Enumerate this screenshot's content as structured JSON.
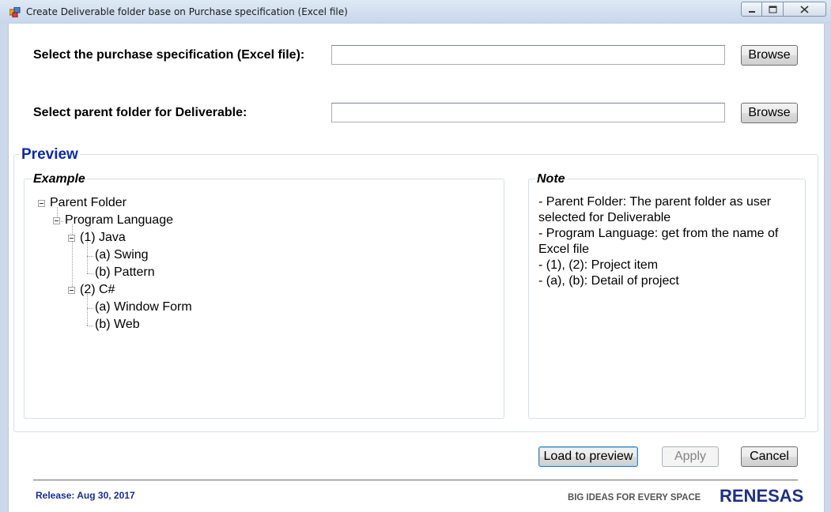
{
  "window": {
    "title": "Create Deliverable folder base on Purchase specification (Excel file)",
    "minimize_glyph": "▬",
    "maximize_glyph": "▢",
    "close_glyph": "✕"
  },
  "form": {
    "purchase_spec_label": "Select the purchase specification (Excel file):",
    "purchase_spec_value": "",
    "parent_folder_label": "Select parent folder for Deliverable:",
    "parent_folder_value": "",
    "browse_label": "Browse"
  },
  "preview": {
    "title": "Preview",
    "example": {
      "title": "Example",
      "tree": {
        "root": "Parent Folder",
        "language": "Program Language",
        "item1": "(1) Java",
        "item1_a": "(a) Swing",
        "item1_b": "(b) Pattern",
        "item2": "(2) C#",
        "item2_a": "(a) Window Form",
        "item2_b": "(b) Web"
      }
    },
    "note": {
      "title": "Note",
      "lines": [
        "- Parent Folder: The parent folder as user",
        "selected for Deliverable",
        "- Program Language: get from the name of",
        "Excel file",
        "- (1), (2): Project item",
        "- (a), (b): Detail of project"
      ]
    }
  },
  "actions": {
    "load_label": "Load to preview",
    "apply_label": "Apply",
    "cancel_label": "Cancel"
  },
  "footer": {
    "release": "Release: Aug 30, 2017",
    "tagline": "BIG IDEAS FOR EVERY SPACE",
    "logo": "RENESAS"
  },
  "colors": {
    "preview_title": "#0d2ba8",
    "release_text": "#1a2e8e",
    "logo": "#1f2f86"
  }
}
